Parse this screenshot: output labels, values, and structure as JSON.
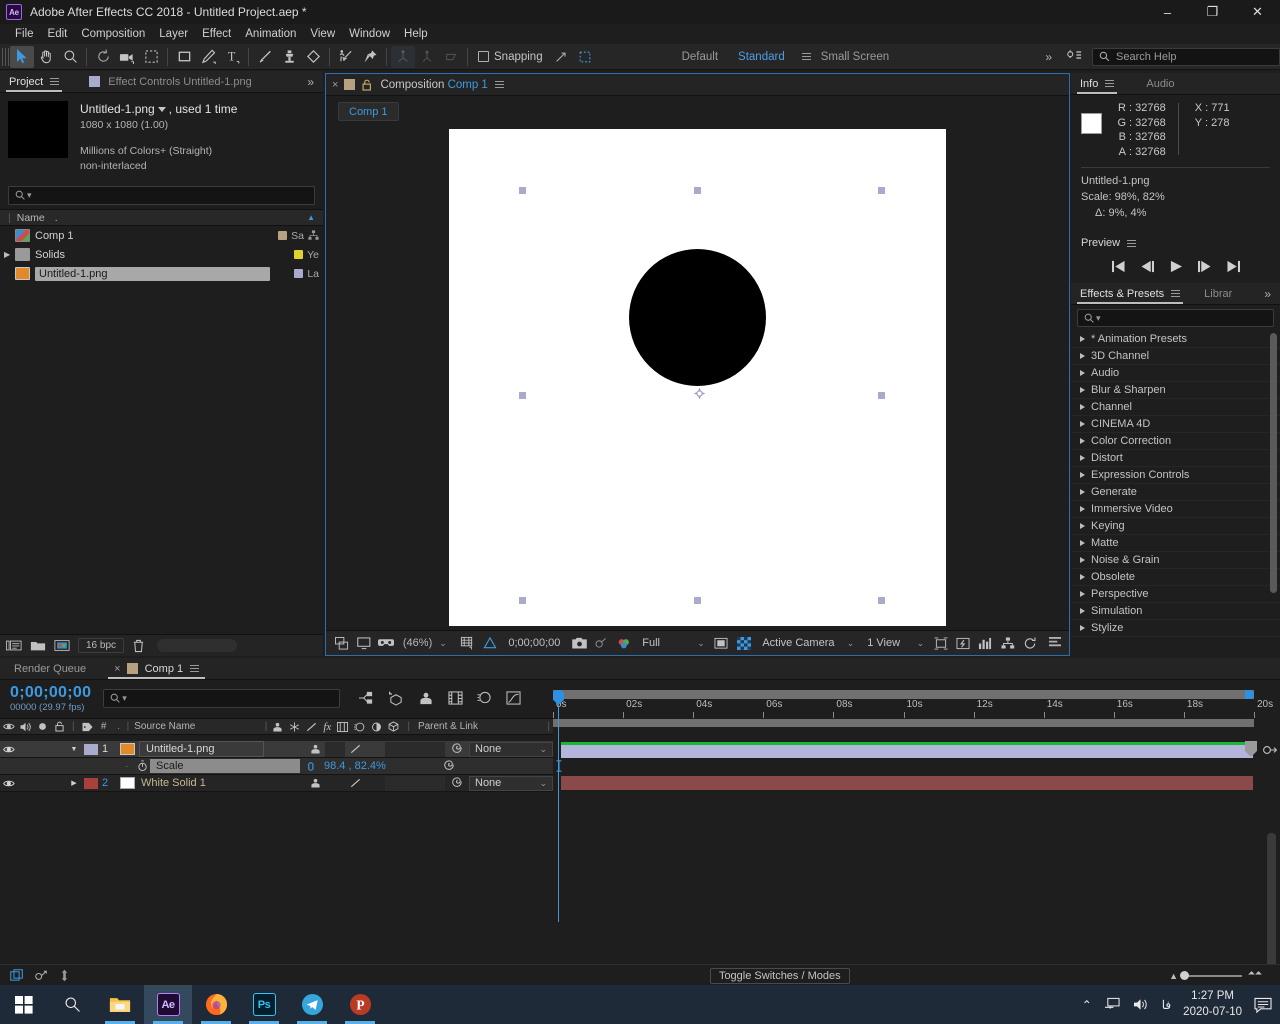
{
  "window": {
    "title": "Adobe After Effects CC 2018 - Untitled Project.aep *",
    "logo": "Ae",
    "minimize": "–",
    "maximize": "❐",
    "close": "✕"
  },
  "menubar": [
    "File",
    "Edit",
    "Composition",
    "Layer",
    "Effect",
    "Animation",
    "View",
    "Window",
    "Help"
  ],
  "toolbar": {
    "snapping_label": "Snapping",
    "workspace_default": "Default",
    "workspace_standard": "Standard",
    "workspace_small_screen": "Small Screen",
    "overflow": "»",
    "search_help": "Search Help"
  },
  "project": {
    "tabs": [
      {
        "label": "Project",
        "active": true
      },
      {
        "label": "Effect Controls Untitled-1.png",
        "active": false
      }
    ],
    "overflow": "»",
    "asset": {
      "name": "Untitled-1.png",
      "used": ", used 1 time",
      "dimensions": "1080 x 1080 (1.00)",
      "color": "Millions of Colors+ (Straight)",
      "interlace": "non-interlaced"
    },
    "search_placeholder": "",
    "column_name": "Name",
    "column_dot": ".",
    "items": [
      {
        "name": "Comp 1",
        "label_text": "Sa",
        "swatch": "#b8a182",
        "kind": "comp",
        "selected": false,
        "expandable": false
      },
      {
        "name": "Solids",
        "label_text": "Ye",
        "swatch": "#e0d22a",
        "kind": "folder",
        "selected": false,
        "expandable": true
      },
      {
        "name": "Untitled-1.png",
        "label_text": "La",
        "swatch": "#a9abcd",
        "kind": "image",
        "selected": true,
        "expandable": false
      }
    ],
    "footer": {
      "bpc": "16 bpc"
    }
  },
  "composition": {
    "close_x": "×",
    "title_prefix": "Composition",
    "title_name": "Comp 1",
    "subtab": "Comp 1",
    "viewer": {
      "zoom": "(46%)",
      "timecode": "0;00;00;00",
      "resolution": "Full",
      "camera": "Active Camera",
      "views": "1 View"
    }
  },
  "info": {
    "tabs": [
      {
        "label": "Info",
        "active": true
      },
      {
        "label": "Audio",
        "active": false
      }
    ],
    "channels": [
      {
        "label": "R",
        "value": "32768"
      },
      {
        "label": "G",
        "value": "32768"
      },
      {
        "label": "B",
        "value": "32768"
      },
      {
        "label": "A",
        "value": "32768"
      }
    ],
    "coords": [
      {
        "label": "X",
        "value": "771"
      },
      {
        "label": "Y",
        "value": "278"
      }
    ],
    "layer_name": "Untitled-1.png",
    "scale": "Scale: 98%, 82%",
    "delta": "Δ: 9%, 4%"
  },
  "preview": {
    "label": "Preview"
  },
  "effects": {
    "tabs": [
      {
        "label": "Effects & Presets",
        "active": true
      },
      {
        "label": "Librar",
        "active": false
      }
    ],
    "overflow": "»",
    "search_placeholder": "",
    "categories": [
      "* Animation Presets",
      "3D Channel",
      "Audio",
      "Blur & Sharpen",
      "Channel",
      "CINEMA 4D",
      "Color Correction",
      "Distort",
      "Expression Controls",
      "Generate",
      "Immersive Video",
      "Keying",
      "Matte",
      "Noise & Grain",
      "Obsolete",
      "Perspective",
      "Simulation",
      "Stylize"
    ]
  },
  "timeline": {
    "tabs": [
      {
        "label": "Render Queue",
        "active": false
      },
      {
        "label": "Comp 1",
        "active": true
      }
    ],
    "close_x": "×",
    "current_time": "0;00;00;00",
    "frame_info": "00000 (29.97 fps)",
    "search_placeholder": "",
    "columns": {
      "source_name": "Source Name",
      "number": "#",
      "dot": ".",
      "parent_link": "Parent & Link"
    },
    "layers": [
      {
        "index": "1",
        "name": "Untitled-1.png",
        "parent": "None",
        "swatch": "#a9abcd",
        "selected": true,
        "expanded": true,
        "bar_color": "#b3b6da",
        "property": {
          "name": "Scale",
          "value": "98.4 , 82.4",
          "unit": "%"
        }
      },
      {
        "index": "2",
        "name": "White Solid 1",
        "parent": "None",
        "swatch": "#a8413c",
        "selected": false,
        "expanded": false,
        "bar_color": "#8a4a4a"
      }
    ],
    "ruler_ticks": [
      "0s",
      "02s",
      "04s",
      "06s",
      "08s",
      "10s",
      "12s",
      "14s",
      "16s",
      "18s",
      "20s"
    ],
    "footer": {
      "toggle_switches": "Toggle Switches / Modes"
    }
  },
  "taskbar": {
    "apps": [
      {
        "name": "start",
        "glyph": "start"
      },
      {
        "name": "search",
        "glyph": "search"
      },
      {
        "name": "file-explorer",
        "glyph": "explorer"
      },
      {
        "name": "after-effects",
        "glyph": "Ae"
      },
      {
        "name": "firefox",
        "glyph": "firefox"
      },
      {
        "name": "photoshop",
        "glyph": "Ps"
      },
      {
        "name": "telegram",
        "glyph": "telegram"
      },
      {
        "name": "app-p",
        "glyph": "P"
      }
    ],
    "lang": "فا",
    "time": "1:27 PM",
    "date": "2020-07-10"
  },
  "colors": {
    "accent_blue": "#3d9ae0",
    "panel_bg": "#1e1e1e",
    "tab_bg": "#242424",
    "selection": "#a8a8a8"
  }
}
